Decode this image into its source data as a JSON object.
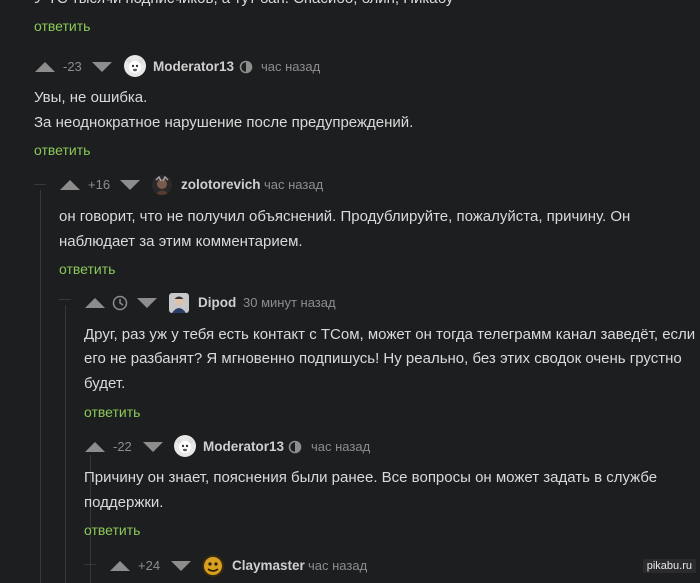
{
  "top": {
    "partial_text": "У ТС тысячи подписчиков, а тут бан. Спасибо, блин, Пикабу",
    "reply": "ответить"
  },
  "c1": {
    "score": "-23",
    "user": "Moderator13",
    "time": "час назад",
    "lines": [
      "Увы, не ошибка.",
      "За неоднократное нарушение после предупреждений."
    ],
    "reply": "ответить"
  },
  "c2": {
    "score": "+16",
    "user": "zolotorevich",
    "time": "час назад",
    "lines": [
      "он говорит, что не получил объяснений. Продублируйте, пожалуйста, причину. Он",
      "наблюдает за этим комментарием."
    ],
    "reply": "ответить"
  },
  "c3": {
    "user": "Dipod",
    "time": "30 минут назад",
    "lines": [
      "Друг, раз уж у тебя есть контакт с ТСом, может он тогда телеграмм канал заведёт, если",
      "его не разбанят? Я мгновенно подпишусь! Ну реально, без этих сводок очень грустно",
      "будет."
    ],
    "reply": "ответить"
  },
  "c4": {
    "score": "-22",
    "user": "Moderator13",
    "time": "час назад",
    "lines": [
      "Причину он знает, пояснения были ранее. Все вопросы он может задать в службе",
      "поддержки."
    ],
    "reply": "ответить"
  },
  "c5": {
    "score": "+24",
    "user": "Claymaster",
    "time": "час назад"
  },
  "watermark": "pikabu.ru",
  "colors": {
    "background": "#1d1e20",
    "reply_link": "#8ac858",
    "arrows": "#8d8d8d"
  }
}
